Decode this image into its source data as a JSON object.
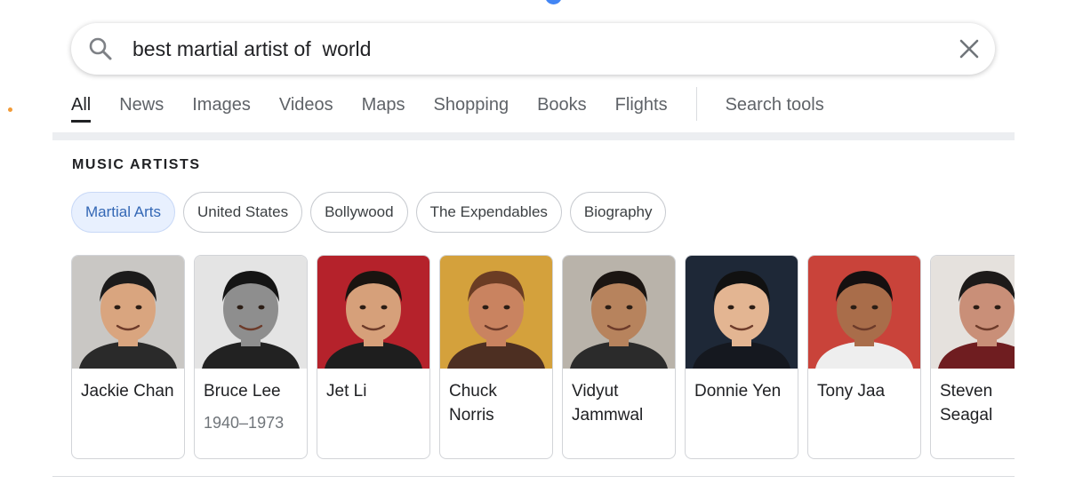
{
  "search": {
    "query": "best martial artist of  world"
  },
  "tabs": [
    {
      "label": "All",
      "active": true
    },
    {
      "label": "News",
      "active": false
    },
    {
      "label": "Images",
      "active": false
    },
    {
      "label": "Videos",
      "active": false
    },
    {
      "label": "Maps",
      "active": false
    },
    {
      "label": "Shopping",
      "active": false
    },
    {
      "label": "Books",
      "active": false
    },
    {
      "label": "Flights",
      "active": false
    }
  ],
  "tools_label": "Search tools",
  "section": {
    "title": "MUSIC ARTISTS"
  },
  "chips": [
    {
      "label": "Martial Arts",
      "selected": true
    },
    {
      "label": "United States",
      "selected": false
    },
    {
      "label": "Bollywood",
      "selected": false
    },
    {
      "label": "The Expendables",
      "selected": false
    },
    {
      "label": "Biography",
      "selected": false
    }
  ],
  "artists": [
    {
      "name": "Jackie Chan",
      "sub": "",
      "bg": "#c9c7c4",
      "skin": "#d9a57f",
      "hair": "#1c1b1b",
      "shirt": "#2a2a2a"
    },
    {
      "name": "Bruce Lee",
      "sub": "1940–1973",
      "bg": "#e4e4e4",
      "skin": "#8e8e8e",
      "hair": "#141414",
      "shirt": "#222222"
    },
    {
      "name": "Jet Li",
      "sub": "",
      "bg": "#b5222b",
      "skin": "#d6a07a",
      "hair": "#1a1410",
      "shirt": "#1e1e1e"
    },
    {
      "name": "Chuck Norris",
      "sub": "",
      "bg": "#d4a13c",
      "skin": "#c98360",
      "hair": "#6b3c24",
      "shirt": "#4d2f22"
    },
    {
      "name": "Vidyut Jammwal",
      "sub": "",
      "bg": "#b9b3aa",
      "skin": "#b7835d",
      "hair": "#1b1512",
      "shirt": "#2b2b2b"
    },
    {
      "name": "Donnie Yen",
      "sub": "",
      "bg": "#1e2837",
      "skin": "#e3b592",
      "hair": "#111111",
      "shirt": "#15181f"
    },
    {
      "name": "Tony Jaa",
      "sub": "",
      "bg": "#c9433a",
      "skin": "#a96d4a",
      "hair": "#151010",
      "shirt": "#eeeeee"
    },
    {
      "name": "Steven Seagal",
      "sub": "",
      "bg": "#e5e1dd",
      "skin": "#c98f78",
      "hair": "#1d1a19",
      "shirt": "#6f1d20"
    }
  ],
  "icons": {
    "search": "search-icon",
    "clear": "close-icon"
  },
  "colors": {
    "accent": "#4285f4",
    "chip_selected_bg": "#e8f0fe",
    "chip_selected_text": "#3367b5"
  }
}
